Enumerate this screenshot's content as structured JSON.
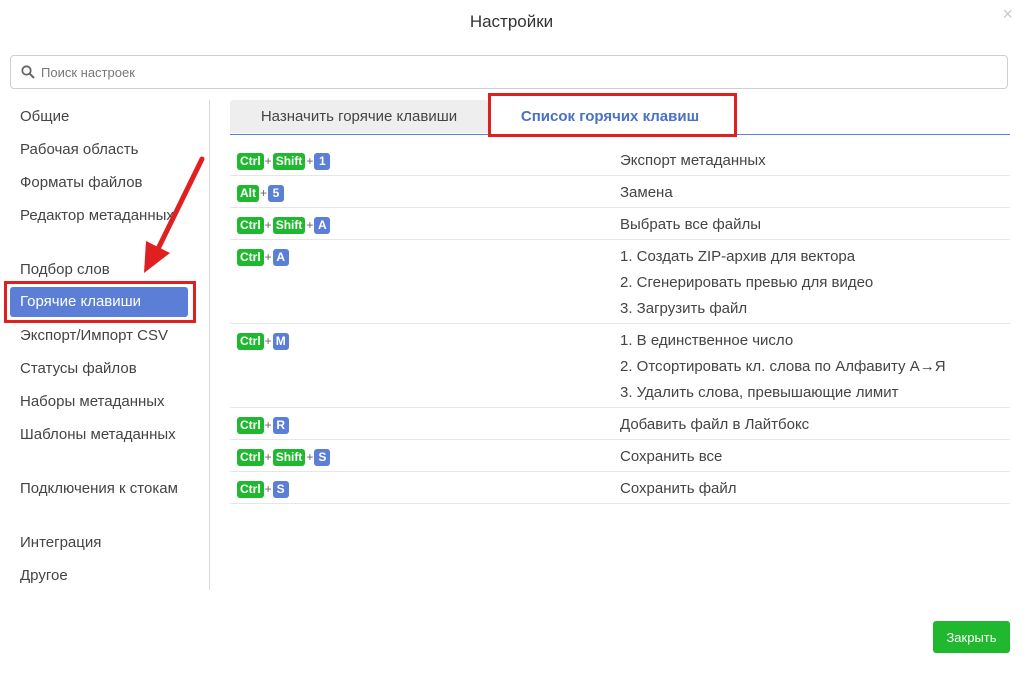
{
  "dialog": {
    "title": "Настройки"
  },
  "close_glyph": "×",
  "search": {
    "placeholder": "Поиск настроек",
    "value": ""
  },
  "sidebar": {
    "items": [
      {
        "label": "Общие"
      },
      {
        "label": "Рабочая область"
      },
      {
        "label": "Форматы файлов"
      },
      {
        "label": "Редактор метаданных"
      },
      {
        "label": "Подбор слов"
      },
      {
        "label": "Горячие клавиши",
        "active": true
      },
      {
        "label": "Экспорт/Импорт CSV"
      },
      {
        "label": "Статусы файлов"
      },
      {
        "label": "Наборы метаданных"
      },
      {
        "label": "Шаблоны метаданных"
      },
      {
        "label": "Подключения к стокам"
      },
      {
        "label": "Интеграция"
      },
      {
        "label": "Другое"
      }
    ]
  },
  "tabs": [
    {
      "label": "Назначить горячие клавиши"
    },
    {
      "label": "Список горячих клавиш",
      "active": true
    }
  ],
  "hotkeys": [
    {
      "keys": [
        "Ctrl",
        "Shift",
        "1"
      ],
      "actions": [
        "Экспорт метаданных"
      ]
    },
    {
      "keys": [
        "Alt",
        "5"
      ],
      "actions": [
        "Замена"
      ]
    },
    {
      "keys": [
        "Ctrl",
        "Shift",
        "A"
      ],
      "actions": [
        "Выбрать все файлы"
      ]
    },
    {
      "keys": [
        "Ctrl",
        "A"
      ],
      "actions": [
        "1. Создать ZIP-архив для вектора",
        "2. Сгенерировать превью для видео",
        "3. Загрузить файл"
      ]
    },
    {
      "keys": [
        "Ctrl",
        "M"
      ],
      "actions": [
        "1. В единственное число",
        "2. Отсортировать кл. слова по Алфавиту А→Я",
        "3. Удалить слова, превышающие лимит"
      ]
    },
    {
      "keys": [
        "Ctrl",
        "R"
      ],
      "actions": [
        "Добавить файл в Лайтбокс"
      ]
    },
    {
      "keys": [
        "Ctrl",
        "Shift",
        "S"
      ],
      "actions": [
        "Сохранить все"
      ]
    },
    {
      "keys": [
        "Ctrl",
        "S"
      ],
      "actions": [
        "Сохранить файл"
      ]
    }
  ],
  "plus_sign": "+",
  "buttons": {
    "close_label": "Закрыть"
  },
  "colors": {
    "accent": "#5b7fd6",
    "modifier_key": "#1fb82f",
    "highlight": "#e02020",
    "primary_button": "#1fb82f"
  }
}
